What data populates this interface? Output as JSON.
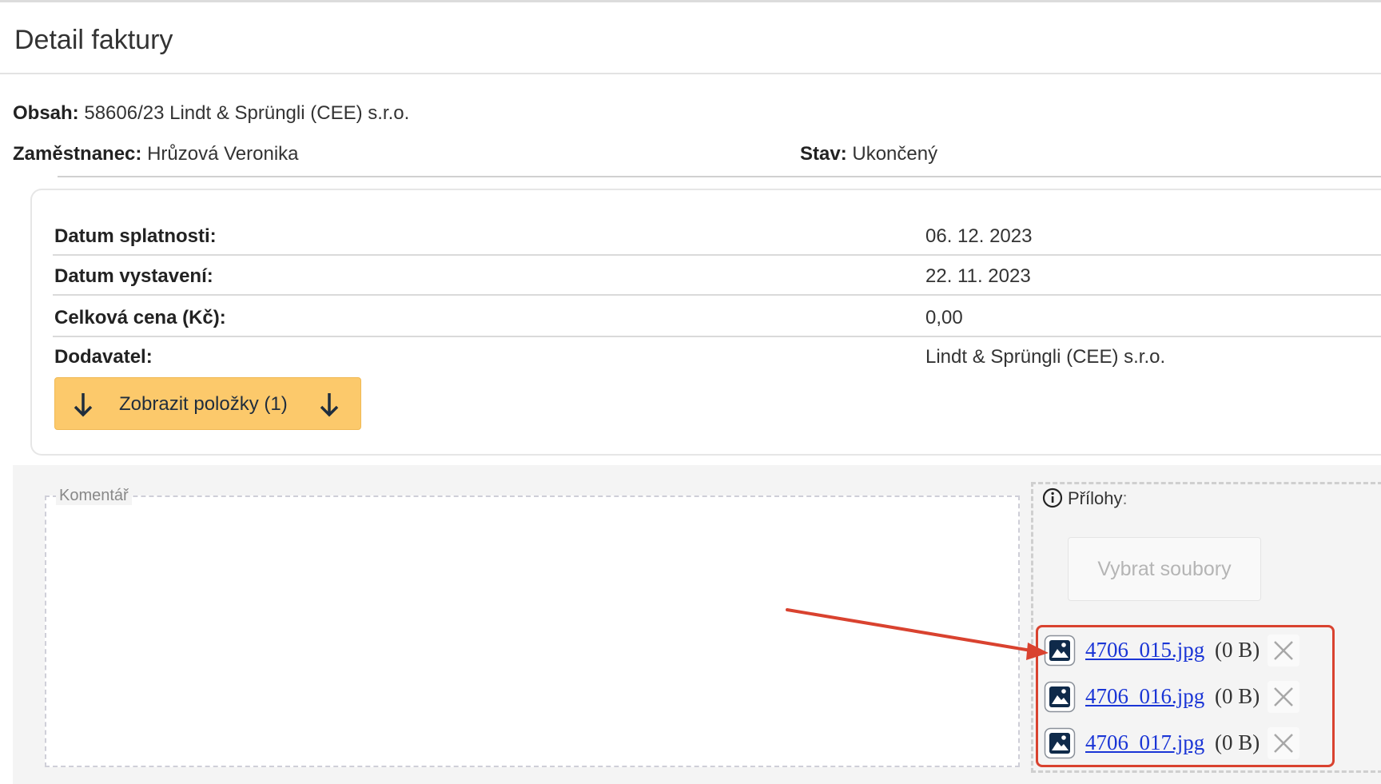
{
  "title": "Detail faktury",
  "info": {
    "obsah_label": "Obsah:",
    "obsah_value": "58606/23 Lindt & Sprüngli (CEE) s.r.o.",
    "employee_label": "Zaměstnanec:",
    "employee_value": "Hrůzová Veronika",
    "status_label": "Stav:",
    "status_value": "Ukončený"
  },
  "details": [
    {
      "label": "Datum splatnosti:",
      "value": "06. 12. 2023"
    },
    {
      "label": "Datum vystavení:",
      "value": "22. 11. 2023"
    },
    {
      "label": "Celková cena (Kč):",
      "value": "0,00"
    },
    {
      "label": "Dodavatel:",
      "value": "Lindt & Sprüngli (CEE) s.r.o."
    }
  ],
  "show_items_button": "Zobrazit položky (1)",
  "comment": {
    "legend": "Komentář"
  },
  "attachments": {
    "heading": "Přílohy",
    "heading_suffix": ":",
    "select_button": "Vybrat soubory",
    "files": [
      {
        "name": "4706_015.jpg",
        "size": "(0 B)"
      },
      {
        "name": "4706_016.jpg",
        "size": "(0 B)"
      },
      {
        "name": "4706_017.jpg",
        "size": "(0 B)"
      }
    ]
  },
  "colors": {
    "button_yellow": "#fcc96b",
    "link_blue": "#1a35d6",
    "annotation_red": "#d9422f",
    "icon_navy": "#0f2a4a"
  }
}
